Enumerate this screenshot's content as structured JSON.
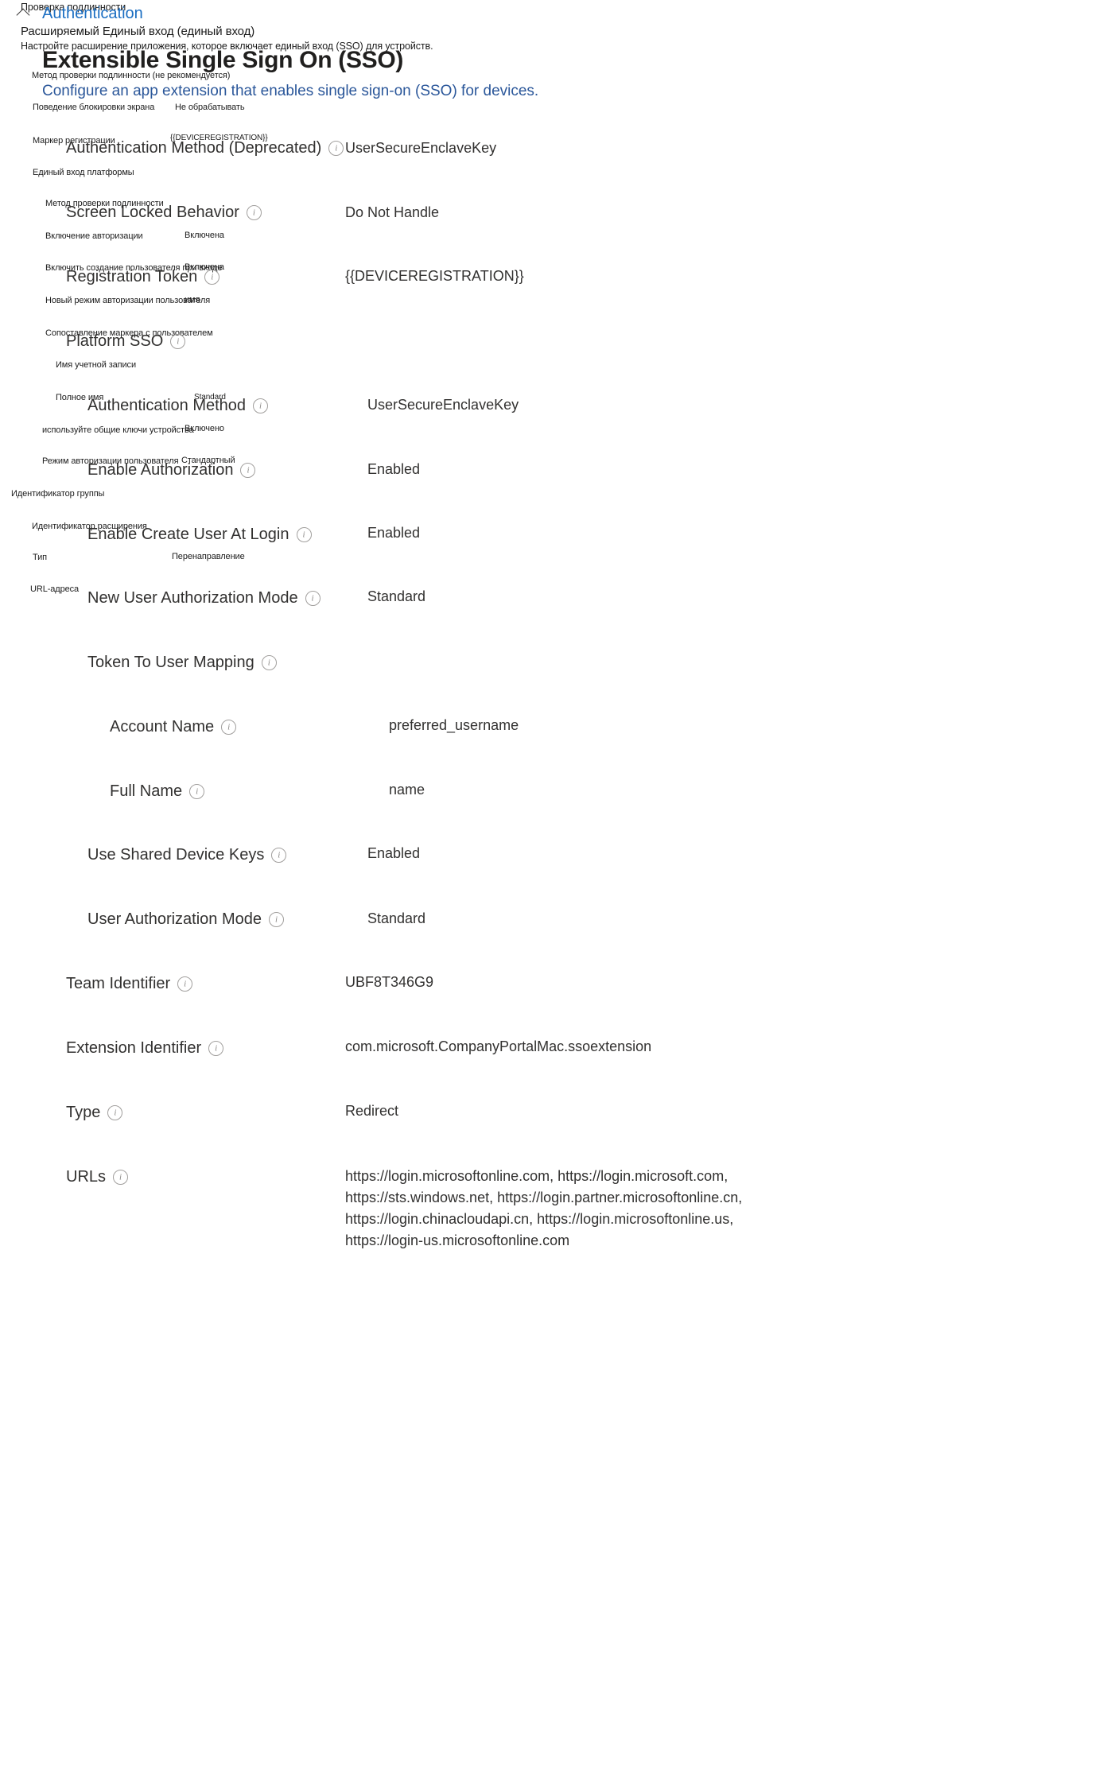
{
  "header": {
    "collapse_icon": "chevron-up-icon",
    "ru_section_label": "Проверка подлинности",
    "en_section_label": "Authentication",
    "ru_subsection_label": "Расширяемый Единый вход (единый вход)",
    "ru_description": "Настройте расширение приложения, которое включает единый вход (SSO) для устройств.",
    "en_page_title": "Extensible Single Sign On (SSO)",
    "en_page_description": "Configure an app extension that enables single sign-on (SSO) for devices."
  },
  "ru_overlay": [
    {
      "label": "Метод проверки подлинности (не рекомендуется)",
      "value": ""
    },
    {
      "label": "Поведение блокировки экрана",
      "value": "Не обрабатывать"
    },
    {
      "label": "Маркер регистрации",
      "value": "{{DEVICEREGISTRATION}}"
    },
    {
      "label": "Единый вход платформы",
      "value": ""
    },
    {
      "label": "Метод проверки подлинности",
      "value": ""
    },
    {
      "label": "Включение авторизации",
      "value": "Включена"
    },
    {
      "label": "Включить создание пользователя при входе",
      "value": "Включена"
    },
    {
      "label": "Новый режим авторизации пользователя",
      "value": "имя"
    },
    {
      "label": "Сопоставление маркера с пользователем",
      "value": ""
    },
    {
      "label": "Имя учетной записи",
      "value": ""
    },
    {
      "label": "Полное имя",
      "value": "Standard"
    },
    {
      "label": "используйте общие ключи устройства",
      "value": "Включено"
    },
    {
      "label": "Режим авторизации пользователя",
      "value": "Стандартный"
    },
    {
      "label": "Идентификатор группы",
      "value": ""
    },
    {
      "label": "Идентификатор расширения",
      "value": ""
    },
    {
      "label": "Тип",
      "value": "Перенаправление"
    },
    {
      "label": "URL-адреса",
      "value": ""
    }
  ],
  "settings": [
    {
      "label": "Authentication Method (Deprecated)",
      "value": "UserSecureEnclaveKey",
      "info": "info-icon"
    },
    {
      "label": "Screen Locked Behavior",
      "value": "Do Not Handle",
      "info": "info-icon"
    },
    {
      "label": "Registration Token",
      "value": "{{DEVICEREGISTRATION}}",
      "info": "info-icon"
    },
    {
      "label": "Platform SSO",
      "value": "",
      "info": "info-icon"
    },
    {
      "label": "Authentication Method",
      "value": "UserSecureEnclaveKey",
      "info": "info-icon"
    },
    {
      "label": "Enable Authorization",
      "value": "Enabled",
      "info": "info-icon"
    },
    {
      "label": "Enable Create User At Login",
      "value": "Enabled",
      "info": "info-icon"
    },
    {
      "label": "New User Authorization Mode",
      "value": "Standard",
      "info": "info-icon"
    },
    {
      "label": "Token To User Mapping",
      "value": "",
      "info": "info-icon"
    },
    {
      "label": "Account Name",
      "value": "preferred_username",
      "info": "info-icon"
    },
    {
      "label": "Full Name",
      "value": "name",
      "info": "info-icon"
    },
    {
      "label": "Use Shared Device Keys",
      "value": "Enabled",
      "info": "info-icon"
    },
    {
      "label": "User Authorization Mode",
      "value": "Standard",
      "info": "info-icon"
    },
    {
      "label": "Team Identifier",
      "value": "UBF8T346G9",
      "info": "info-icon"
    },
    {
      "label": "Extension Identifier",
      "value": "com.microsoft.CompanyPortalMac.ssoextension",
      "info": "info-icon"
    },
    {
      "label": "Type",
      "value": "Redirect",
      "info": "info-icon"
    },
    {
      "label": "URLs",
      "value": "https://login.microsoftonline.com, https://login.microsoft.com, https://sts.windows.net, https://login.partner.microsoftonline.cn, https://login.chinacloudapi.cn, https://login.microsoftonline.us, https://login-us.microsoftonline.com",
      "info": "info-icon"
    }
  ],
  "colors": {
    "link": "#1b6ec2",
    "subtitle": "#2b579a",
    "text": "#323130",
    "icon_border": "#a19f9d"
  }
}
